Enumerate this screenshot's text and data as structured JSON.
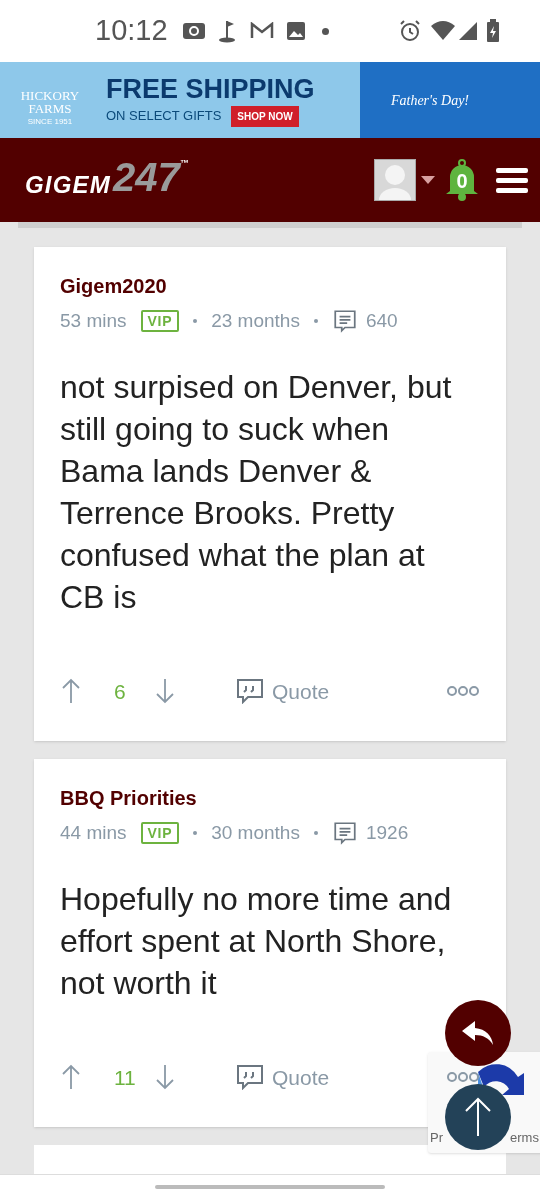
{
  "status_bar": {
    "time": "10:12"
  },
  "ad": {
    "brand": "HICKORY FARMS",
    "since": "SINCE 1951",
    "headline": "FREE SHIPPING",
    "subline": "ON SELECT GIFTS",
    "cta": "SHOP NOW",
    "occasion": "Father's Day!"
  },
  "header": {
    "logo_main": "GIGEM",
    "logo_number": "247",
    "trademark": "™",
    "notifications": "0"
  },
  "posts": [
    {
      "author": "Gigem2020",
      "time": "53 mins",
      "badge": "VIP",
      "tenure": "23 months",
      "post_count": "640",
      "body": "not surpised on Denver, but still going to suck when Bama lands Denver & Terrence Brooks. Pretty confused what the plan at CB is",
      "votes": "6",
      "quote": "Quote"
    },
    {
      "author": "BBQ Priorities",
      "time": "44 mins",
      "badge": "VIP",
      "tenure": "30 months",
      "post_count": "1926",
      "body": "Hopefully no more time and effort spent at North Shore, not worth it",
      "votes": "11",
      "quote": "Quote"
    }
  ],
  "recaptcha": {
    "left_text": "Pr",
    "right_text": "erms"
  }
}
